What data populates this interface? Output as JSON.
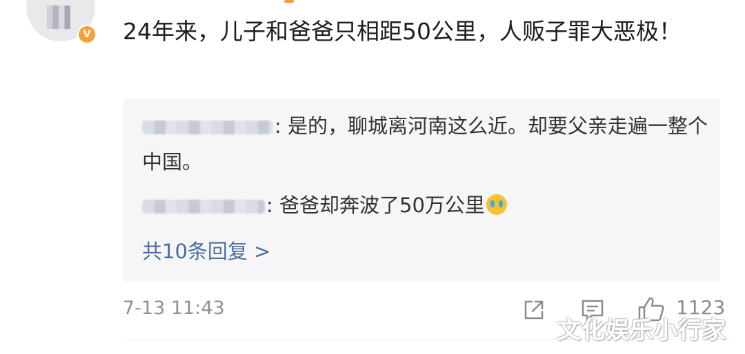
{
  "comment": {
    "text": "24年来，儿子和爸爸只相距50公里，人贩子罪大恶极！"
  },
  "replies": [
    {
      "text": ": 是的，聊城离河南这么近。却要父亲走遍一整个中国。"
    },
    {
      "text": ": 爸爸却奔波了50万公里",
      "emoji": "crying-face-icon"
    }
  ],
  "more_replies_label": "共10条回复 >",
  "meta": {
    "time": "7-13 11:43",
    "like_count": "1123"
  },
  "icons": {
    "share": "share-icon",
    "comment": "comment-icon",
    "like": "thumbs-up-icon"
  },
  "watermark": "文化娱乐小行家",
  "colors": {
    "link": "#4a6d9e",
    "reply_bg": "#f6f6f8",
    "meta_text": "#8f8f95",
    "badge": "#f6a13a"
  }
}
